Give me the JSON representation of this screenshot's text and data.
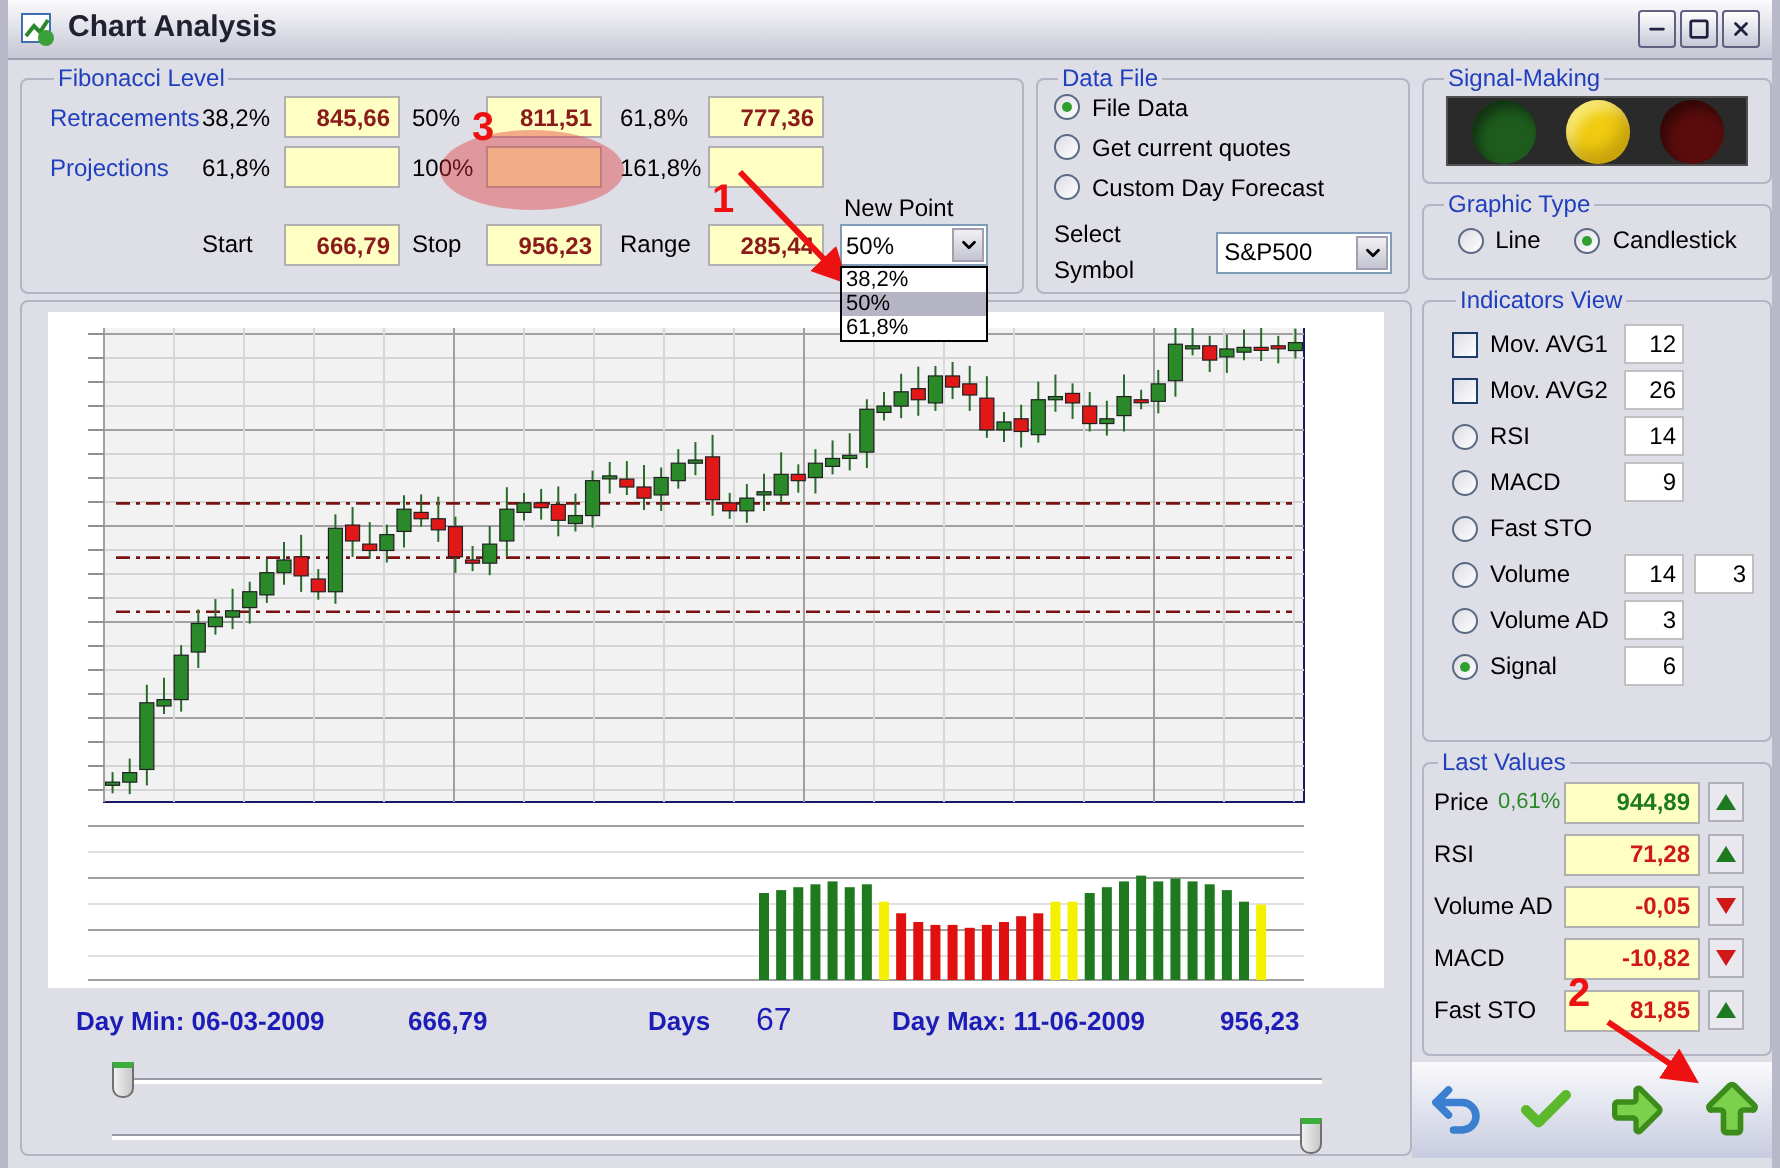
{
  "window": {
    "title": "Chart Analysis"
  },
  "fibonacci": {
    "title": "Fibonacci Level",
    "rows": [
      {
        "label": "Retracements",
        "cells": [
          {
            "pct": "38,2%",
            "value": "845,66"
          },
          {
            "pct": "50%",
            "value": "811,51"
          },
          {
            "pct": "61,8%",
            "value": "777,36"
          }
        ]
      },
      {
        "label": "Projections",
        "cells": [
          {
            "pct": "61,8%"
          },
          {
            "pct": "100%"
          },
          {
            "pct": "161,8%"
          }
        ]
      }
    ],
    "range": [
      {
        "label": "Start",
        "value": "666,79"
      },
      {
        "label": "Stop",
        "value": "956,23"
      },
      {
        "label": "Range",
        "value": "285,44"
      }
    ],
    "new_point": {
      "label": "New Point",
      "value": "50%",
      "expanded": true,
      "options": [
        {
          "label": "38,2%",
          "selected": false
        },
        {
          "label": "50%",
          "selected": true
        },
        {
          "label": "61,8%",
          "selected": false
        }
      ]
    }
  },
  "data_file": {
    "title": "Data File",
    "sources": [
      {
        "label": "File Data",
        "selected": true
      },
      {
        "label": "Get current quotes",
        "selected": false
      },
      {
        "label": "Custom Day Forecast",
        "selected": false
      }
    ],
    "symbol_label": "Select Symbol",
    "symbol": "S&P500"
  },
  "signal": {
    "title": "Signal-Making",
    "lights": [
      {
        "color": "#1e5c1e",
        "on": false
      },
      {
        "color": "#f0cc10",
        "on": true
      },
      {
        "color": "#5a0c0c",
        "on": false
      }
    ]
  },
  "graphic_type": {
    "title": "Graphic Type",
    "options": [
      {
        "label": "Line",
        "selected": false
      },
      {
        "label": "Candlestick",
        "selected": true
      }
    ]
  },
  "indicators": {
    "title": "Indicators View",
    "items": [
      {
        "kind": "checkbox",
        "label": "Mov. AVG1",
        "checked": false,
        "params": [
          "12"
        ]
      },
      {
        "kind": "checkbox",
        "label": "Mov. AVG2",
        "checked": false,
        "params": [
          "26"
        ]
      },
      {
        "kind": "radio",
        "label": "RSI",
        "selected": false,
        "params": [
          "14"
        ]
      },
      {
        "kind": "radio",
        "label": "MACD",
        "selected": false,
        "params": [
          "9"
        ]
      },
      {
        "kind": "radio",
        "label": "Fast STO",
        "selected": false
      },
      {
        "kind": "radio",
        "label": "Volume",
        "selected": false,
        "params": [
          "14",
          "3"
        ]
      },
      {
        "kind": "radio",
        "label": "Volume AD",
        "selected": false,
        "params": [
          "3"
        ]
      },
      {
        "kind": "radio",
        "label": "Signal",
        "selected": true,
        "params": [
          "6"
        ]
      }
    ]
  },
  "last_values": {
    "title": "Last Values",
    "rows": [
      {
        "label": "Price",
        "change": "0,61%",
        "value": "944,89",
        "color": "#1e7a1e",
        "rising": true
      },
      {
        "label": "RSI",
        "value": "71,28",
        "color": "#d01818",
        "rising": true
      },
      {
        "label": "Volume AD",
        "value": "-0,05",
        "color": "#d01818",
        "rising": false
      },
      {
        "label": "MACD",
        "value": "-10,82",
        "color": "#d01818",
        "rising": false
      },
      {
        "label": "Fast STO",
        "value": "81,85",
        "color": "#d01818",
        "rising": true
      }
    ]
  },
  "stats": {
    "day_min": "Day Min: 06-03-2009",
    "day_min_value": "666,79",
    "days_label": "Days",
    "days": "67",
    "day_max": "Day Max: 11-06-2009",
    "day_max_value": "956,23"
  },
  "sliders": [
    {
      "level": 0.0
    },
    {
      "level": 1.0
    }
  ],
  "annotations": [
    "1",
    "2",
    "3"
  ]
}
